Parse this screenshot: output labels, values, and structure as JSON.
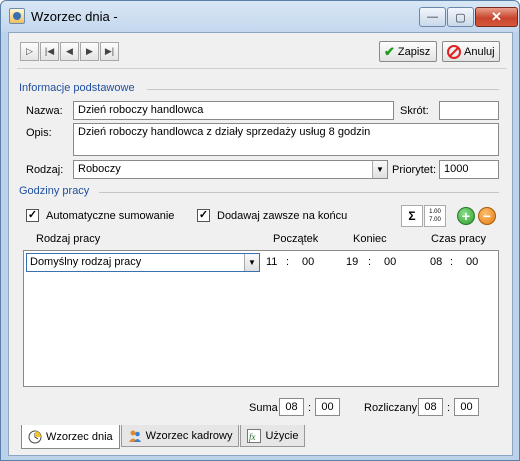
{
  "window": {
    "title": "Wzorzec dnia -",
    "minimize": "—",
    "maximize": "▢",
    "close": "✕"
  },
  "toolbar": {
    "nav_icons": [
      "first-icon",
      "prev-step-icon",
      "prev-icon",
      "next-icon",
      "last-icon"
    ],
    "nav_glyphs": [
      "▷",
      "|◀",
      "◀",
      "▶",
      "▶|"
    ],
    "save_label": "Zapisz",
    "cancel_label": "Anuluj"
  },
  "basic": {
    "section_title": "Informacje podstawowe",
    "name_label": "Nazwa:",
    "name_value": "Dzień roboczy handlowca",
    "abbrev_label": "Skrót:",
    "abbrev_value": "",
    "desc_label": "Opis:",
    "desc_value": "Dzień roboczy handlowca z działy sprzedaży usług 8 godzin",
    "type_label": "Rodzaj:",
    "type_value": "Roboczy",
    "priority_label": "Priorytet:",
    "priority_value": "1000"
  },
  "hours": {
    "section_title": "Godziny pracy",
    "auto_sum_label": "Automatyczne sumowanie",
    "auto_sum_checked": true,
    "always_end_label": "Dodawaj zawsze na końcu",
    "always_end_checked": true,
    "sum_icon_text": "Σ",
    "time_icon_text": "1.00 7.00",
    "add_label": "+",
    "remove_label": "−",
    "columns": [
      "Rodzaj pracy",
      "Początek",
      "Koniec",
      "Czas pracy"
    ],
    "rows": [
      {
        "type": "Domyślny rodzaj pracy",
        "start_h": "11",
        "start_m": "00",
        "end_h": "19",
        "end_m": "00",
        "dur_h": "08",
        "dur_m": "00"
      }
    ],
    "colon": ":",
    "sum_label": "Suma",
    "sum_h": "08",
    "sum_m": "00",
    "settled_label": "Rozliczany",
    "settled_h": "08",
    "settled_m": "00"
  },
  "tabs": [
    {
      "label": "Wzorzec dnia",
      "active": true
    },
    {
      "label": "Wzorzec kadrowy",
      "active": false
    },
    {
      "label": "Użycie",
      "active": false
    }
  ]
}
